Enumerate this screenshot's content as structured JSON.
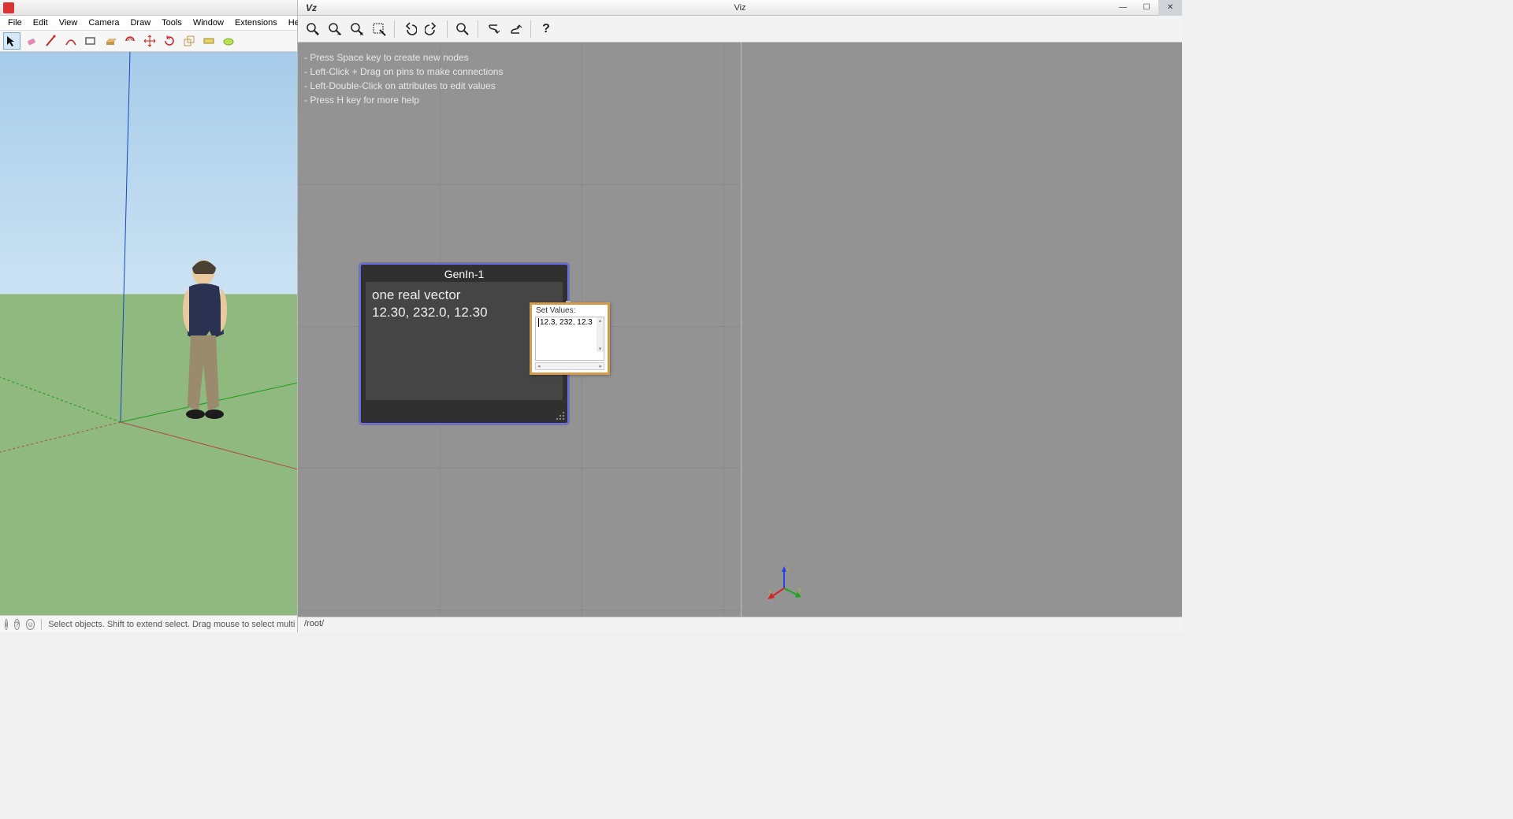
{
  "sketchup": {
    "menu": [
      "File",
      "Edit",
      "View",
      "Camera",
      "Draw",
      "Tools",
      "Window",
      "Extensions",
      "Help"
    ],
    "status_text": "Select objects. Shift to extend select. Drag mouse to select multi",
    "toolbar_names": [
      "select",
      "eraser",
      "line",
      "arc",
      "shape",
      "pushpull",
      "offset",
      "move",
      "rotate",
      "scale",
      "tape",
      "paint"
    ]
  },
  "viz": {
    "logo": "Vz",
    "title": "Viz",
    "hints": [
      "- Press Space key to create new nodes",
      "- Left-Click + Drag on pins to make connections",
      "- Left-Double-Click on attributes to edit values",
      "- Press H key for more help"
    ],
    "node": {
      "title": "GenIn-1",
      "line1": "one real vector",
      "line2": "12.30,  232.0,  12.30"
    },
    "popup": {
      "title": "Set Values:",
      "text": "12.3, 232, 12.3"
    },
    "path": "/root/",
    "toolbar_left": [
      "zoom-in",
      "zoom-out",
      "zoom-reset",
      "select-box",
      "undo",
      "redo",
      "find",
      "link-down",
      "link-up",
      "help"
    ],
    "toolbar_right": [
      "zoom-in",
      "zoom-out",
      "zoom-reset"
    ]
  }
}
